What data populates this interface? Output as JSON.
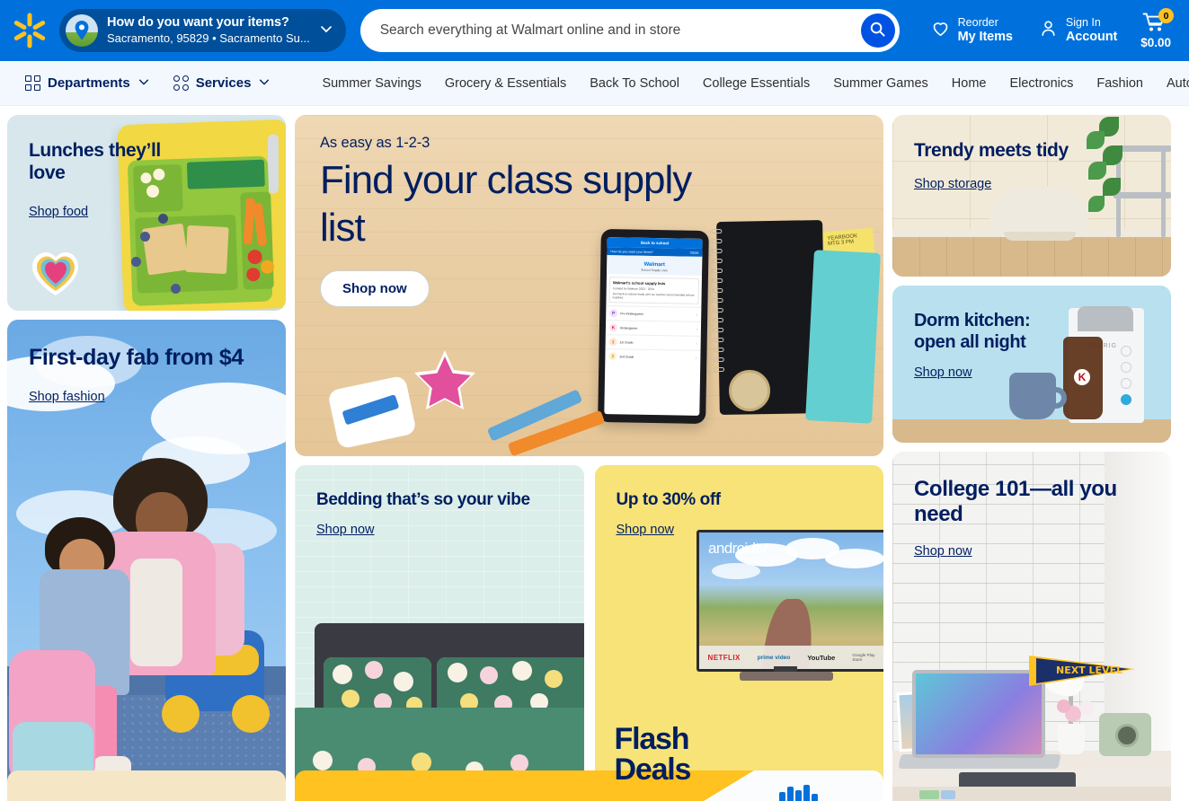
{
  "header": {
    "logo_icon": "walmart-spark-icon",
    "fulfillment": {
      "icon": "location-pin-icon",
      "title": "How do you want your items?",
      "subtitle": "Sacramento, 95829 • Sacramento Su...",
      "chevron_icon": "chevron-down-icon"
    },
    "search": {
      "placeholder": "Search everything at Walmart online and in store",
      "value": "",
      "button_icon": "search-icon"
    },
    "actions": [
      {
        "icon": "heart-icon",
        "top": "Reorder",
        "bottom": "My Items"
      },
      {
        "icon": "person-icon",
        "top": "Sign In",
        "bottom": "Account"
      }
    ],
    "cart": {
      "icon": "shopping-cart-icon",
      "badge": "0",
      "total": "$0.00"
    }
  },
  "nav": {
    "departments": {
      "label": "Departments",
      "icon": "grid-squares-icon",
      "chevron_icon": "chevron-down-icon"
    },
    "services": {
      "label": "Services",
      "icon": "grid-circles-icon",
      "chevron_icon": "chevron-down-icon"
    },
    "links": [
      "Summer Savings",
      "Grocery & Essentials",
      "Back To School",
      "College Essentials",
      "Summer Games",
      "Home",
      "Electronics",
      "Fashion",
      "Auto"
    ]
  },
  "cards": {
    "lunches": {
      "title": "Lunches they’ll love",
      "link": "Shop food"
    },
    "firstday": {
      "title": "First-day fab from $4",
      "link": "Shop fashion"
    },
    "hero": {
      "eyebrow": "As easy as 1-2-3",
      "title": "Find your class supply list",
      "button": "Shop now",
      "tablet": {
        "app_title": "Back to school",
        "location": "How do you want your items?",
        "zip": "75026",
        "brand": "Walmart",
        "brand_sub": "School Supply Lists",
        "list_title": "Walmart's school supply lists",
        "list_meta": "Curated by Walmart   2023 - 2024",
        "list_desc": "Get back-to-school ready with our teacher-recommended school supplies.",
        "grades": [
          {
            "badge": "P",
            "label": "Pre-Kindergarten"
          },
          {
            "badge": "K",
            "label": "Kindergarten"
          },
          {
            "badge": "1",
            "label": "1st Grade"
          },
          {
            "badge": "2",
            "label": "2nd Grade"
          }
        ],
        "sticky_note": "YEARBOOK MTG 3 PM"
      }
    },
    "bedding": {
      "title": "Bedding that’s so your vibe",
      "link": "Shop now"
    },
    "flash": {
      "title": "Up to 30% off",
      "link": "Shop now",
      "word_line1": "Flash",
      "word_line2": "Deals",
      "tv_logo": "androidtv",
      "tv_apps": [
        "NETFLIX",
        "prime video",
        "YouTube",
        "Google Play Store"
      ]
    },
    "trendy": {
      "title": "Trendy meets tidy",
      "link": "Shop storage"
    },
    "dorm": {
      "title": "Dorm kitchen: open all night",
      "link": "Shop now",
      "brand": "KEURIG"
    },
    "college": {
      "title": "College 101—all you need",
      "link": "Shop now",
      "pennant": "NEXT LEVEL"
    }
  },
  "colors": {
    "brand_blue": "#0071dc",
    "brand_dark_blue": "#001e60",
    "brand_yellow": "#ffc220",
    "nav_bg": "#f2f8fd"
  }
}
